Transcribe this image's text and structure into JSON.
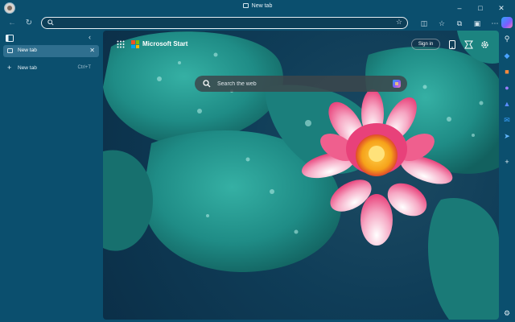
{
  "window": {
    "title": "New tab",
    "buttons": {
      "minimize": "–",
      "maximize": "□",
      "close": "✕"
    }
  },
  "toolbar": {
    "back_glyph": "←",
    "refresh_glyph": "↻",
    "address_value": "",
    "favorite_glyph": "☆",
    "icons": [
      "split-screen-icon",
      "favorites-icon",
      "collections-icon",
      "extensions-icon",
      "more-icon"
    ],
    "icon_glyphs": [
      "◫",
      "☆",
      "⧉",
      "▣",
      "⋯"
    ]
  },
  "sidebar": {
    "tabs": [
      {
        "label": "New tab",
        "close_glyph": "✕"
      }
    ],
    "new_tab": {
      "label": "New tab",
      "shortcut": "Ctrl+T",
      "plus": "+"
    },
    "collapse_glyph": "‹"
  },
  "newtab_page": {
    "brand": "Microsoft Start",
    "sign_in": "Sign in",
    "search_placeholder": "Search the web"
  },
  "colors": {
    "frame": "#0b4f6e",
    "tab_active": "#2f6f8f",
    "pad_green": "#1f8c86",
    "lotus_pink": "#f05a8a"
  }
}
